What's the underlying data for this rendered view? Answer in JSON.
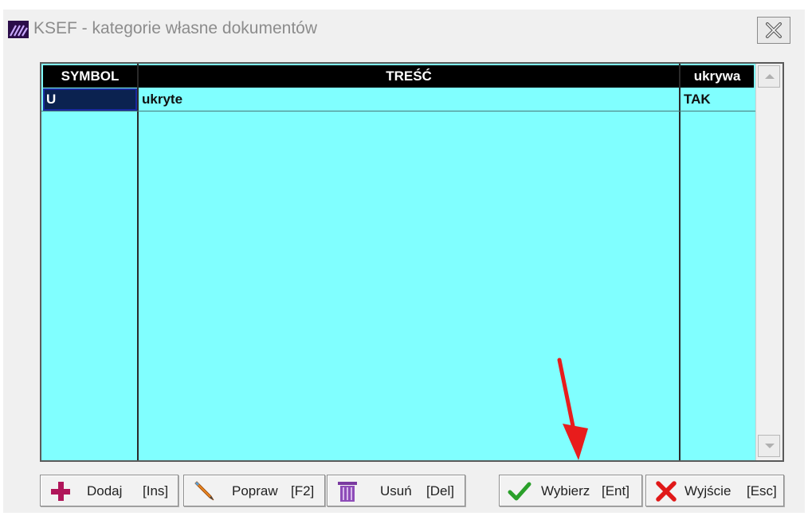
{
  "window": {
    "title": "KSEF - kategorie własne dokumentów"
  },
  "grid": {
    "columns": [
      "SYMBOL",
      "TREŚĆ",
      "ukrywa"
    ],
    "rows": [
      {
        "symbol": "U",
        "tresc": "ukryte",
        "ukrywa": "TAK"
      }
    ]
  },
  "buttons": {
    "add": {
      "label": "Dodaj",
      "key": "[Ins]",
      "icon": "plus-icon"
    },
    "edit": {
      "label": "Popraw",
      "key": "[F2]",
      "icon": "pencil-icon"
    },
    "delete": {
      "label": "Usuń",
      "key": "[Del]",
      "icon": "trash-icon"
    },
    "select": {
      "label": "Wybierz",
      "key": "[Ent]",
      "icon": "checkmark-icon"
    },
    "exit": {
      "label": "Wyjście",
      "key": "[Esc]",
      "icon": "x-icon"
    }
  },
  "colors": {
    "grid_background": "#80ffff",
    "header_background": "#000000",
    "annotation_arrow": "#e81c1c"
  }
}
